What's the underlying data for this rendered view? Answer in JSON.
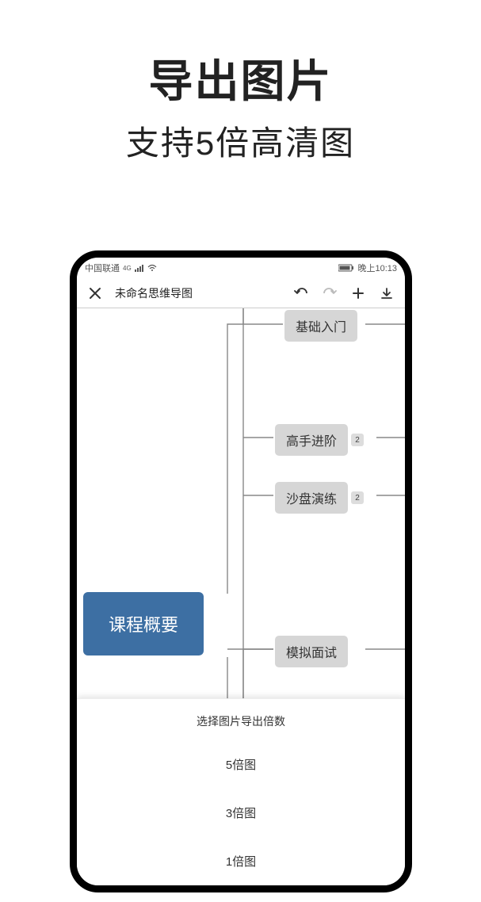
{
  "promo": {
    "title": "导出图片",
    "subtitle": "支持5倍高清图"
  },
  "statusbar": {
    "carrier": "中国联通",
    "net_label": "4G",
    "time": "晚上10:13"
  },
  "toolbar": {
    "title": "未命名思维导图"
  },
  "mindmap": {
    "root": "课程概要",
    "nodes": {
      "n1": {
        "label": "基础入门"
      },
      "n2": {
        "label": "高手进阶",
        "badge": "2"
      },
      "n3": {
        "label": "沙盘演练",
        "badge": "2"
      },
      "n4": {
        "label": "模拟面试"
      }
    }
  },
  "sheet": {
    "title": "选择图片导出倍数",
    "options": {
      "o1": "5倍图",
      "o2": "3倍图",
      "o3": "1倍图"
    }
  }
}
